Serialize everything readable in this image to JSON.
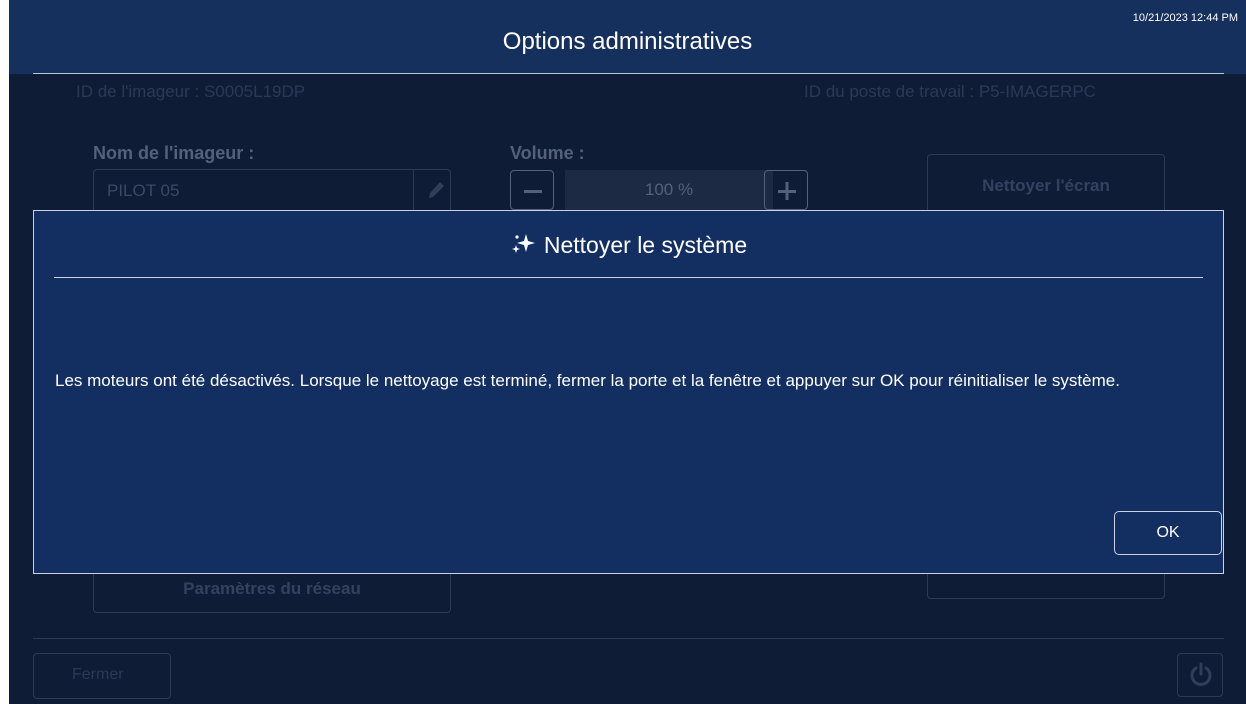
{
  "header": {
    "timestamp": "10/21/2023 12:44 PM",
    "title": "Options administratives"
  },
  "background": {
    "imager_id": "ID de l'imageur : S0005L19DP",
    "workstation_id": "ID du poste de travail : P5-IMAGERPC",
    "imager_name_label": "Nom de l'imageur :",
    "imager_name_value": "PILOT 05",
    "volume_label": "Volume :",
    "volume_value": "100 %",
    "clean_screen_label": "Nettoyer l'écran",
    "network_settings_label": "Paramètres du réseau",
    "close_label": "Fermer"
  },
  "modal": {
    "title": "Nettoyer le système",
    "message": "Les moteurs ont été désactivés. Lorsque le nettoyage est terminé, fermer la porte et la fenêtre et appuyer sur OK pour réinitialiser le système.",
    "ok_label": "OK",
    "icon": "sparkle-icon"
  },
  "colors": {
    "topbar": "#16305e",
    "background": "#0f1c35",
    "modal": "#132f62"
  }
}
